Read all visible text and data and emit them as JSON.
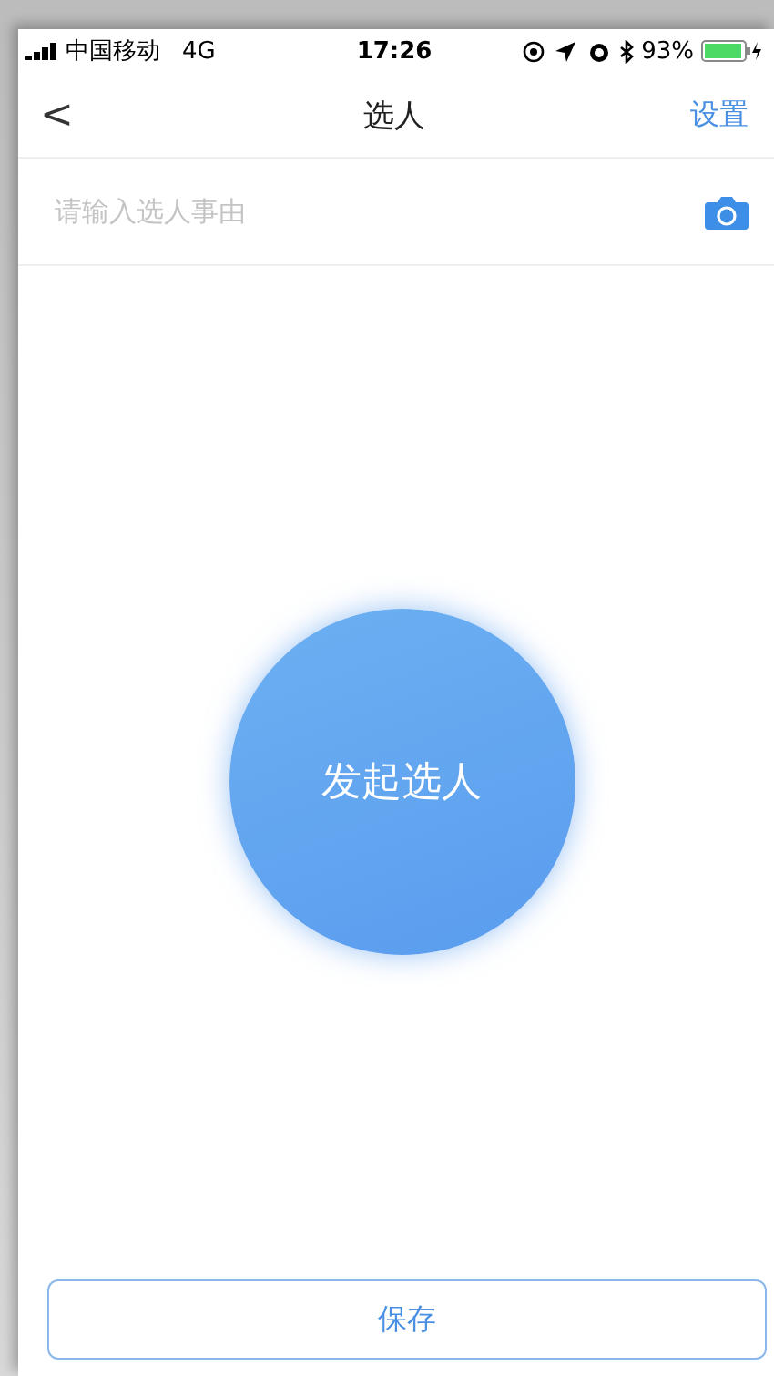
{
  "status_bar": {
    "carrier": "中国移动",
    "network": "4G",
    "time": "17:26",
    "battery": "93%"
  },
  "nav": {
    "back": "<",
    "title": "选人",
    "action": "设置"
  },
  "reason_field": {
    "placeholder": "请输入选人事由"
  },
  "start_button": {
    "label": "发起选人"
  },
  "save_button": {
    "label": "保存"
  }
}
